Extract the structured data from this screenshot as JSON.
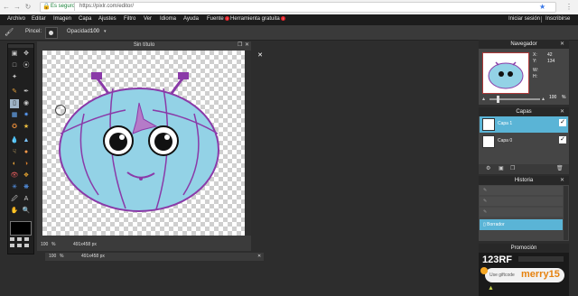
{
  "browser": {
    "secure_label": "Es seguro",
    "url": "https://pixlr.com/editor/"
  },
  "menu": {
    "items": [
      "Archivo",
      "Editar",
      "Imagen",
      "Capa",
      "Ajustes",
      "Filtro",
      "Ver",
      "Idioma",
      "Ayuda"
    ],
    "fuente": "Fuente",
    "herramienta": "Herramienta gratuita",
    "badge": "!",
    "signin": "Iniciar sesión",
    "signup": "Inscribirse"
  },
  "options": {
    "pincel_label": "Pincel:",
    "opacidad_label": "Opacidad:",
    "opacidad_value": "100"
  },
  "document": {
    "title": "Sin título",
    "zoom": "100",
    "zoom_unit": "%",
    "size": "491x458 px"
  },
  "navigator": {
    "title": "Navegador",
    "x_label": "X:",
    "x_value": "42",
    "y_label": "Y:",
    "y_value": "134",
    "w_label": "W:",
    "h_label": "H:",
    "zoom": "100",
    "zoom_unit": "%"
  },
  "layers": {
    "title": "Capas",
    "items": [
      "Capa 1",
      "Capa 0"
    ]
  },
  "history": {
    "title": "Historia",
    "active": "Borrador"
  },
  "promo": {
    "title": "Promoción",
    "brand": "123RF",
    "gift_text": "Use giftcode",
    "gift_code": "merry15"
  }
}
